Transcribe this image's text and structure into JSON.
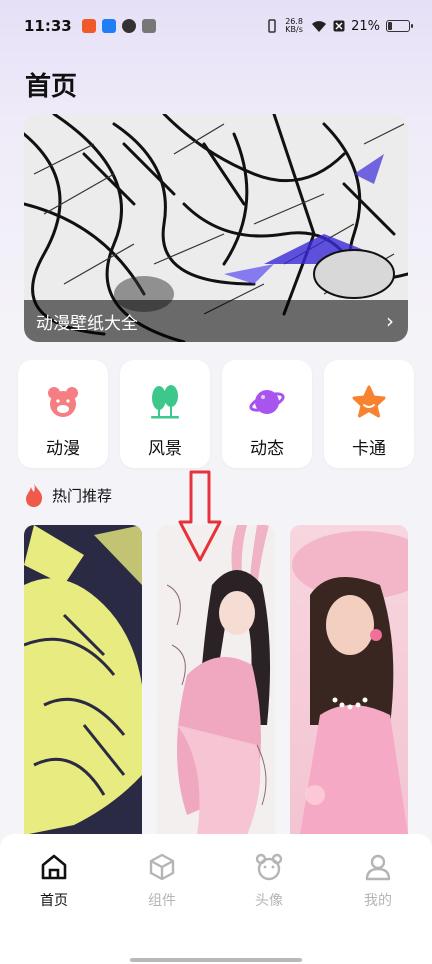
{
  "status_bar": {
    "time": "11:33",
    "speed_value": "26.8",
    "speed_unit": "KB/s",
    "battery": "21%",
    "battery_level": 0.21
  },
  "page": {
    "title": "首页"
  },
  "banner": {
    "caption": "动漫壁纸大全"
  },
  "categories": [
    {
      "label": "动漫",
      "icon": "bear-icon",
      "color": "#f47e82"
    },
    {
      "label": "风景",
      "icon": "trees-icon",
      "color": "#3dc78a"
    },
    {
      "label": "动态",
      "icon": "planet-icon",
      "color": "#a855f0"
    },
    {
      "label": "卡通",
      "icon": "star-icon",
      "color": "#f8822f"
    }
  ],
  "hot_section": {
    "label": "热门推荐",
    "icon": "flame-icon",
    "color": "#f05a4a"
  },
  "wallpapers": [
    {
      "name": "sketch-yellow-wallpaper"
    },
    {
      "name": "bunny-girl-wallpaper"
    },
    {
      "name": "pink-hat-girl-wallpaper"
    }
  ],
  "bottom_nav": [
    {
      "label": "首页",
      "icon": "home-icon",
      "active": true
    },
    {
      "label": "组件",
      "icon": "cube-icon",
      "active": false
    },
    {
      "label": "头像",
      "icon": "bear-face-icon",
      "active": false
    },
    {
      "label": "我的",
      "icon": "person-icon",
      "active": false
    }
  ]
}
